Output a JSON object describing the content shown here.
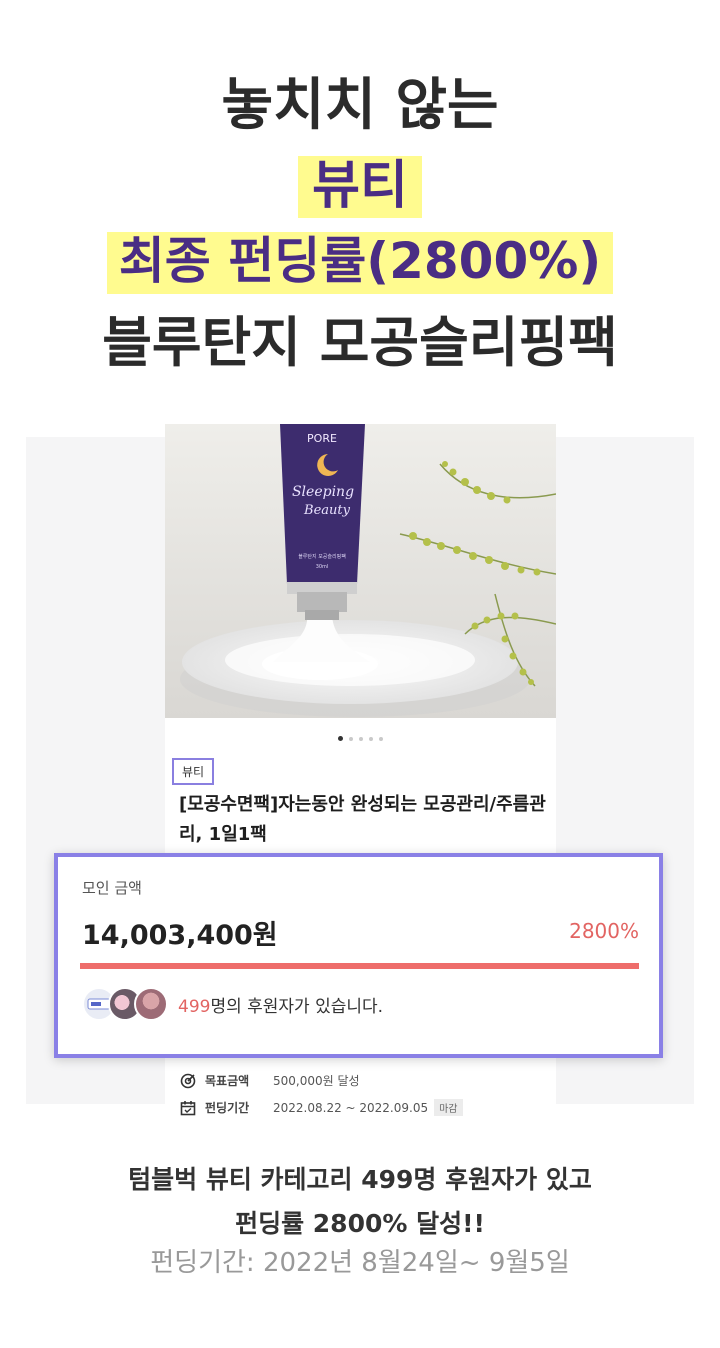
{
  "headline": {
    "line1": "놓치치 않는",
    "category": "뷰티",
    "rate_line": "최종 펀딩률(2800%)",
    "product_line": "블루탄지 모공슬리핑팩"
  },
  "card": {
    "image_text": {
      "brand": "PORE",
      "script_line1": "Sleeping",
      "script_line2": "Beauty",
      "small_line": "블루탄지 모공슬리핑팩",
      "volume": "30ml"
    },
    "carousel_dots": 5,
    "carousel_active": 0,
    "category_tag": "뷰티",
    "title": "[모공수면팩]자는동안 완성되는 모공관리/주름관리, 1일1팩",
    "goal": {
      "label": "목표금액",
      "value": "500,000원 달성"
    },
    "period": {
      "label": "펀딩기간",
      "value": "2022.08.22 ~ 2022.09.05",
      "badge": "마감"
    }
  },
  "amount_box": {
    "label": "모인 금액",
    "amount": "14,003,400원",
    "percent": "2800%",
    "progress_fraction": 1.0,
    "supporter_count": "499",
    "supporter_suffix": "명의 후원자가 있습니다."
  },
  "footer": {
    "line1": "텀블벅 뷰티 카테고리 499명 후원자가 있고",
    "line2": "펀딩률 2800% 달성!!",
    "line3": "펀딩기간: 2022년 8월24일~ 9월5일"
  },
  "colors": {
    "highlight": "#fffb8f",
    "purple": "#4a2d84",
    "accent_red": "#e26462",
    "box_border": "#8a80e6"
  }
}
